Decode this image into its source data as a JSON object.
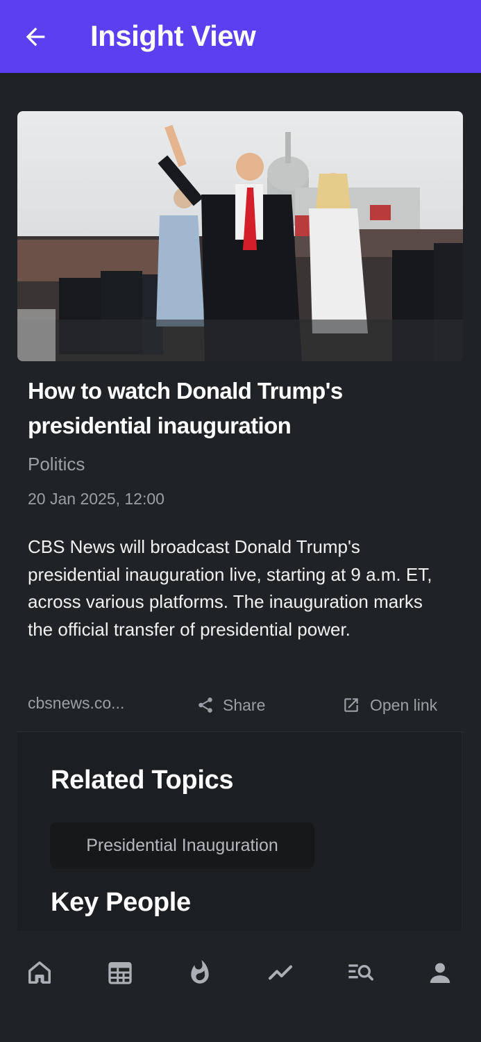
{
  "app_bar": {
    "title": "Insight View"
  },
  "article": {
    "headline": "How to watch Donald Trump's presidential inauguration",
    "category": "Politics",
    "timestamp": "20 Jan 2025, 12:00",
    "summary": "CBS News will broadcast Donald Trump's presidential inauguration live, starting at 9 a.m. ET, across various platforms. The inauguration marks the official transfer of presidential power.",
    "source": "cbsnews.co...",
    "share_label": "Share",
    "open_link_label": "Open link"
  },
  "related_topics": {
    "title": "Related Topics",
    "chips": [
      "Presidential Inauguration"
    ]
  },
  "key_people": {
    "title": "Key People"
  },
  "bottom_nav": {
    "items": [
      "home-icon",
      "calendar-icon",
      "fire-icon",
      "trending-icon",
      "search-list-icon",
      "profile-icon"
    ]
  },
  "colors": {
    "app_bar": "#5b3ff0",
    "background": "#1f2326",
    "muted_text": "#9aa0a6",
    "chip_bg": "#16181a",
    "icon": "#aab0b6"
  }
}
